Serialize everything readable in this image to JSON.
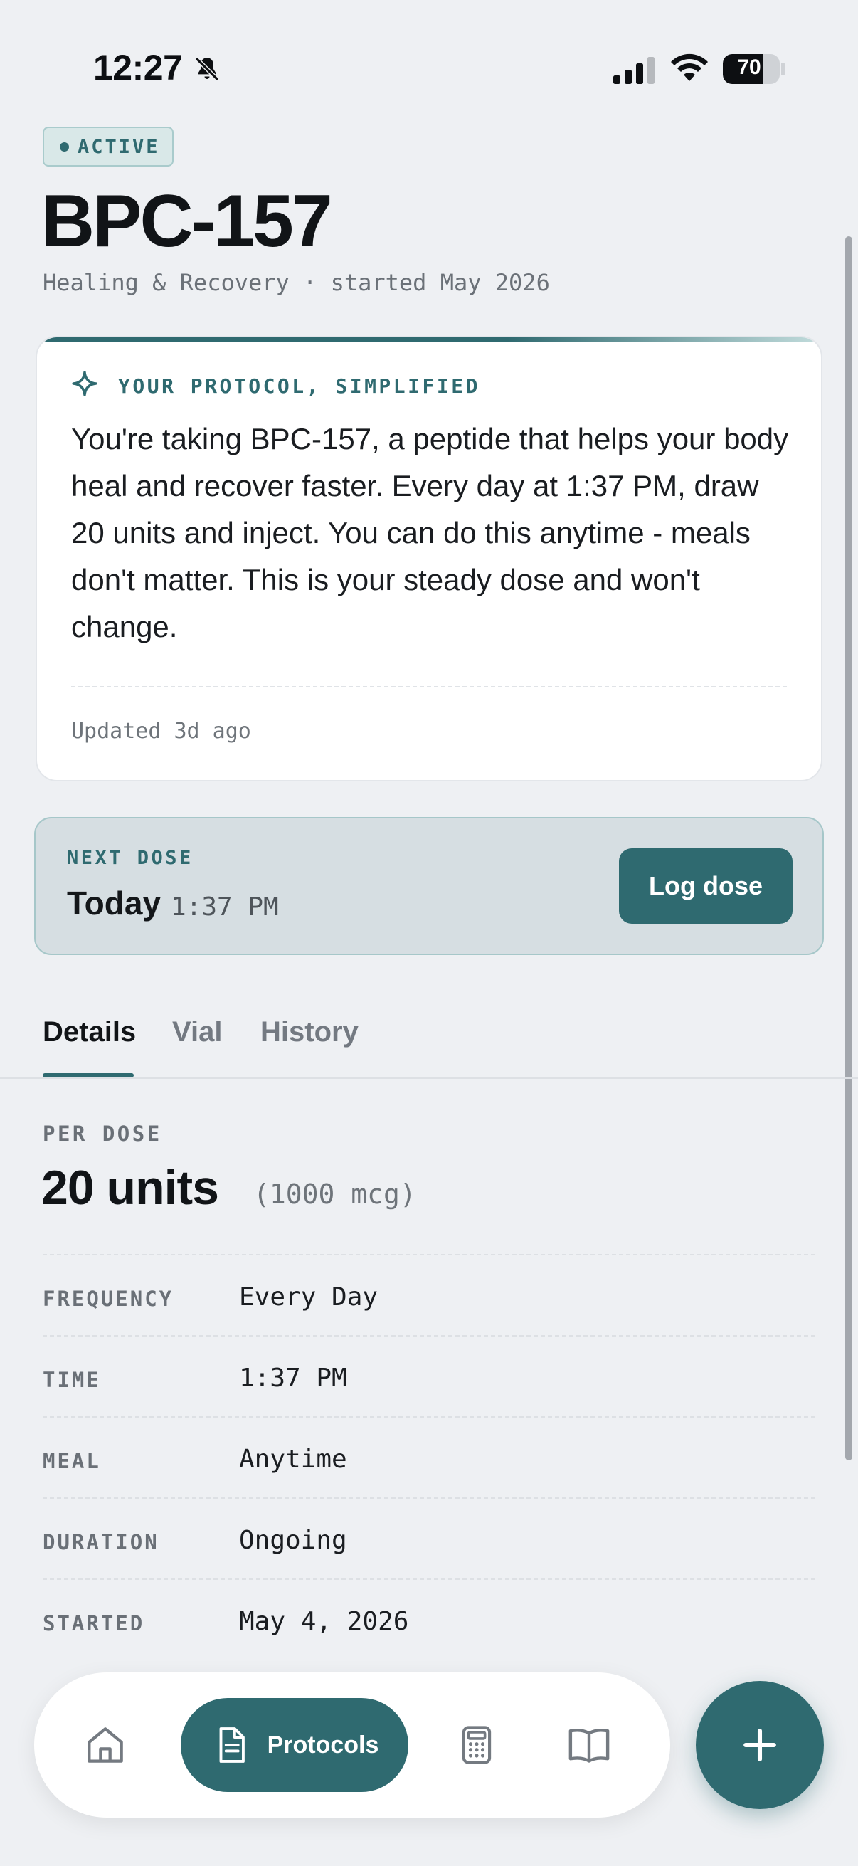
{
  "status_bar": {
    "time": "12:27",
    "battery": "70",
    "battery_level": 0.7
  },
  "header": {
    "badge": "ACTIVE",
    "title": "BPC-157",
    "subtitle": "Healing & Recovery · started May 2026"
  },
  "summary": {
    "label": "YOUR PROTOCOL, SIMPLIFIED",
    "text": "You're taking BPC-157, a peptide that helps your body heal and recover faster. Every day at 1:37 PM, draw 20 units and inject. You can do this anytime - meals don't matter. This is your steady dose and won't change.",
    "updated": "Updated 3d ago"
  },
  "next_dose": {
    "label": "NEXT DOSE",
    "day": "Today",
    "time": "1:37 PM",
    "button": "Log dose"
  },
  "tabs": [
    {
      "label": "Details",
      "active": true
    },
    {
      "label": "Vial",
      "active": false
    },
    {
      "label": "History",
      "active": false
    }
  ],
  "details": {
    "per_dose_label": "PER DOSE",
    "per_dose_value": "20 units",
    "per_dose_mcg": "(1000 mcg)",
    "rows": [
      {
        "label": "FREQUENCY",
        "value": "Every Day"
      },
      {
        "label": "TIME",
        "value": "1:37 PM"
      },
      {
        "label": "MEAL",
        "value": "Anytime"
      },
      {
        "label": "DURATION",
        "value": "Ongoing"
      },
      {
        "label": "STARTED",
        "value": "May 4, 2026"
      }
    ]
  },
  "bottom_nav": {
    "items": [
      {
        "icon": "home-icon"
      },
      {
        "icon": "document-icon",
        "label": "Protocols",
        "active": true
      },
      {
        "icon": "calculator-icon"
      },
      {
        "icon": "book-icon"
      }
    ],
    "fab_icon": "plus-icon"
  },
  "colors": {
    "accent": "#2f6a70",
    "background": "#eef0f3",
    "card": "#ffffff"
  }
}
